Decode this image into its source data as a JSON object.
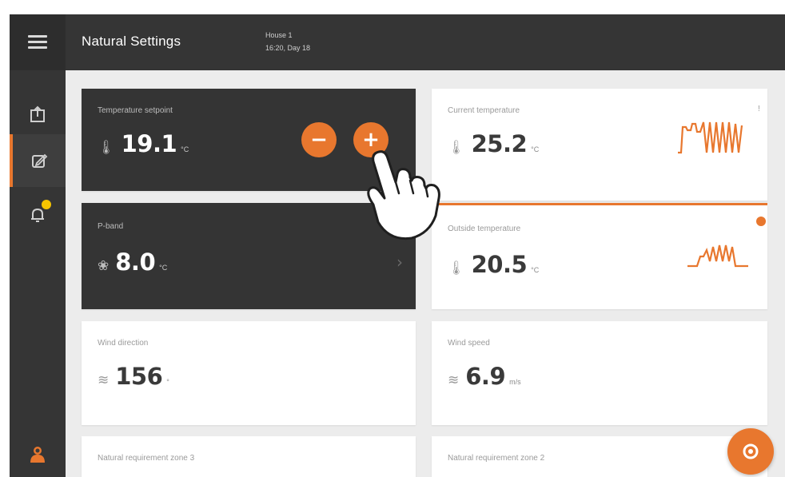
{
  "header": {
    "title": "Natural Settings",
    "sub_line1": "House 1",
    "sub_line2": "16:20, Day 18"
  },
  "sidebar": {
    "items": [
      {
        "icon": "menu-icon"
      },
      {
        "icon": "upload-icon"
      },
      {
        "icon": "settings-edit-icon",
        "active": true
      },
      {
        "icon": "alert-icon",
        "badge": true
      },
      {
        "icon": "user-icon"
      }
    ]
  },
  "cards": {
    "setpoint": {
      "label": "Temperature setpoint",
      "value": "19.1",
      "unit": "°C",
      "minus": "−",
      "plus": "+"
    },
    "pband": {
      "label": "P-band",
      "value": "8.0",
      "unit": "°C",
      "arrow": "›"
    },
    "current_temp": {
      "label": "Current temperature",
      "value": "25.2",
      "unit": "°C",
      "mark": "!"
    },
    "outside_temp": {
      "label": "Outside temperature",
      "value": "20.5",
      "unit": "°C"
    },
    "wind_direction": {
      "label": "Wind direction",
      "value": "156",
      "unit": "°"
    },
    "wind_speed": {
      "label": "Wind speed",
      "value": "6.9",
      "unit": "m/s"
    },
    "zone3": {
      "label": "Natural requirement zone 3"
    },
    "zone2": {
      "label": "Natural requirement zone 2"
    }
  },
  "colors": {
    "accent": "#e8772e",
    "dark": "#343434",
    "badge": "#f5c400"
  }
}
